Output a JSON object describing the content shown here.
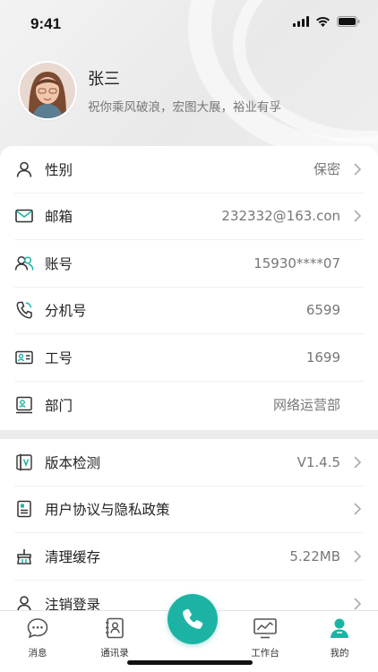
{
  "status": {
    "time": "9:41"
  },
  "profile": {
    "name": "张三",
    "motto": "祝你乘风破浪，宏图大展，裕业有孚"
  },
  "info": [
    {
      "key": "gender",
      "label": "性别",
      "value": "保密",
      "arrow": true,
      "icon": "person-icon"
    },
    {
      "key": "email",
      "label": "邮箱",
      "value": "232332@163.con",
      "arrow": true,
      "icon": "mail-icon"
    },
    {
      "key": "account",
      "label": "账号",
      "value": "15930****07",
      "arrow": false,
      "icon": "users-icon"
    },
    {
      "key": "extension",
      "label": "分机号",
      "value": "6599",
      "arrow": false,
      "icon": "phone-icon"
    },
    {
      "key": "employee_id",
      "label": "工号",
      "value": "1699",
      "arrow": false,
      "icon": "id-card-icon"
    },
    {
      "key": "department",
      "label": "部门",
      "value": "网络运营部",
      "arrow": false,
      "icon": "department-icon"
    }
  ],
  "settings": [
    {
      "key": "version",
      "label": "版本检测",
      "value": "V1.4.5",
      "arrow": true,
      "icon": "version-icon"
    },
    {
      "key": "agreement",
      "label": "用户协议与隐私政策",
      "value": "",
      "arrow": true,
      "icon": "document-icon"
    },
    {
      "key": "cache",
      "label": "清理缓存",
      "value": "5.22MB",
      "arrow": true,
      "icon": "broom-icon"
    },
    {
      "key": "logout",
      "label": "注销登录",
      "value": "",
      "arrow": true,
      "icon": "logout-user-icon"
    }
  ],
  "tabs": [
    {
      "key": "messages",
      "label": "消息",
      "icon": "chat-icon"
    },
    {
      "key": "contacts",
      "label": "通讯录",
      "icon": "contacts-icon"
    },
    {
      "key": "workbench",
      "label": "工作台",
      "icon": "monitor-icon"
    },
    {
      "key": "mine",
      "label": "我的",
      "icon": "user-icon",
      "active": true
    }
  ],
  "colors": {
    "accent": "#1db3a4",
    "text": "#222222",
    "muted": "#777777"
  }
}
